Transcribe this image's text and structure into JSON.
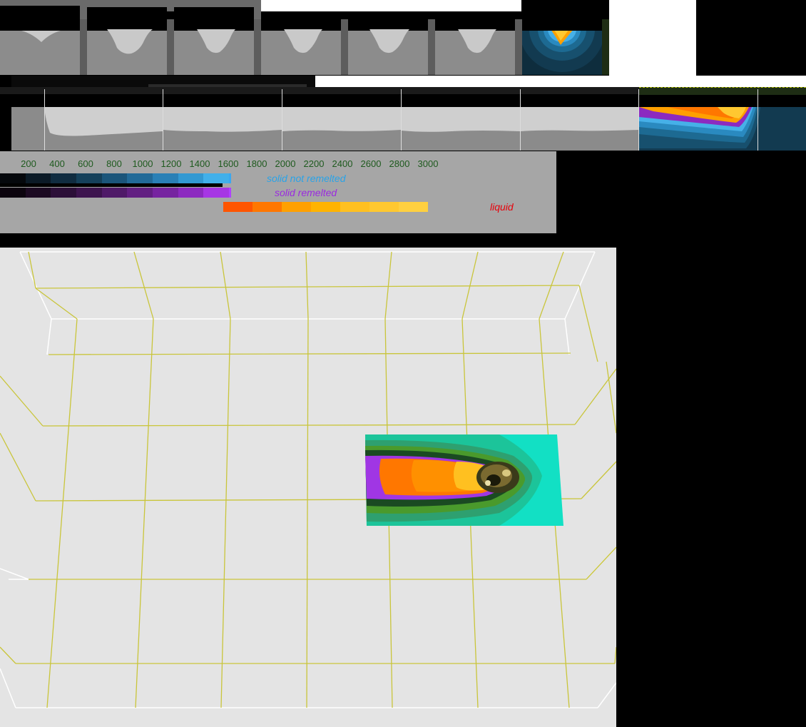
{
  "legend": {
    "ticks": [
      "200",
      "400",
      "600",
      "800",
      "1000",
      "1200",
      "1400",
      "1600",
      "1800",
      "2000",
      "2200",
      "2400",
      "2600",
      "2800",
      "3000"
    ],
    "solid_not_remelted_label": "solid not remelted",
    "solid_remelted_label": "solid remelted",
    "liquid_label": "liquid",
    "colors": {
      "solid_not_remelted": [
        "#05080c",
        "#0b1a26",
        "#102c40",
        "#15405a",
        "#1b557a",
        "#226a98",
        "#2a80b6",
        "#3399d2",
        "#42b0ea"
      ],
      "solid_remelted": [
        "#0c040e",
        "#1c0a22",
        "#2c0f38",
        "#3d144e",
        "#4f1a68",
        "#621f82",
        "#7624a0",
        "#8c2ac0",
        "#a636e4"
      ],
      "liquid": [
        "#ff5500",
        "#ff7700",
        "#ffa000",
        "#ffb300",
        "#ffc020",
        "#ffc830",
        "#ffd040"
      ],
      "solid_not_remelted_text": "#29a3e8",
      "solid_remelted_text": "#9a2ae0",
      "liquid_text": "#e8000a",
      "tick_text": "#1e5a1e"
    }
  }
}
